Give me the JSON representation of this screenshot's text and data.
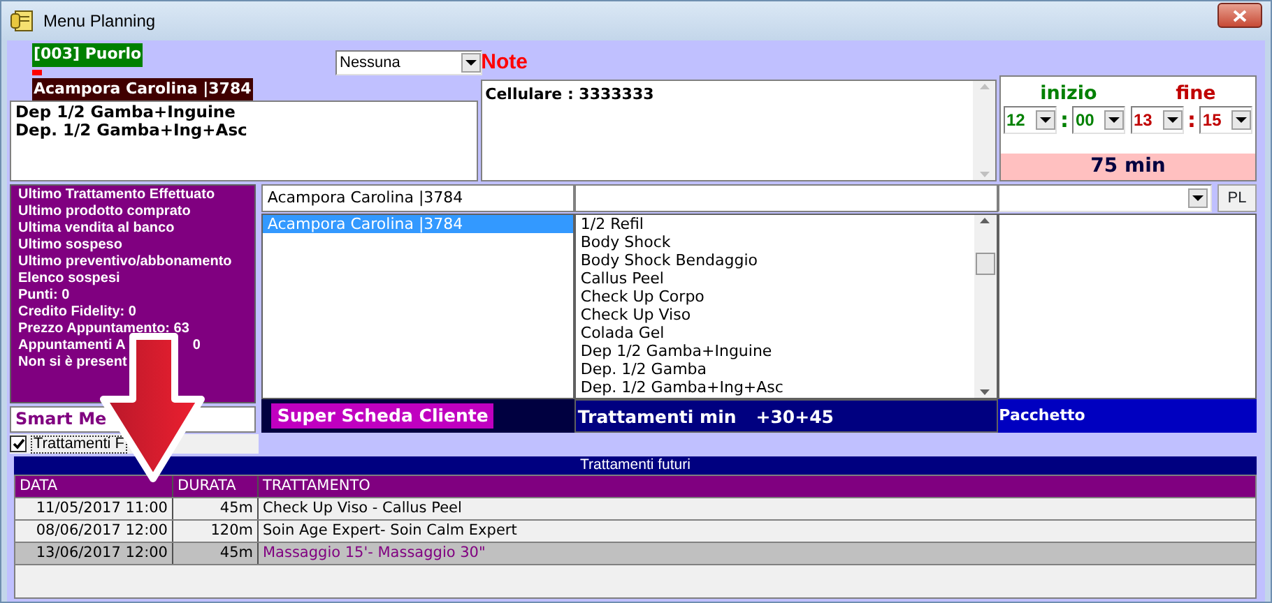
{
  "window": {
    "title": "Menu Planning"
  },
  "client": {
    "code_name": "[003] Puorlo",
    "name": "Acampora Carolina |3784",
    "treatments": [
      "Dep 1/2 Gamba+Inguine",
      "Dep. 1/2 Gamba+Ing+Asc"
    ]
  },
  "note_type": {
    "value": "Nessuna"
  },
  "note": {
    "label": "Note",
    "text": "Cellulare : 3333333"
  },
  "time": {
    "start_label": "inizio",
    "end_label": "fine",
    "start_hour": "12",
    "start_separator": ":",
    "start_minute": "00",
    "end_hour": "13",
    "end_separator": ":",
    "end_minute": "15",
    "duration": "75 min"
  },
  "info_menu": [
    {
      "text": "Ultimo Trattamento Effettuato"
    },
    {
      "text": "Ultimo prodotto comprato"
    },
    {
      "text": "Ultima vendita al banco"
    },
    {
      "text": "Ultimo sospeso"
    },
    {
      "text": "Ultimo preventivo/abbonamento"
    },
    {
      "text": "Elenco sospesi"
    },
    {
      "text": "Punti: 0"
    },
    {
      "text": "Credito Fidelity: 0"
    },
    {
      "text": "Prezzo Appuntamento: 63"
    },
    {
      "text": "Appuntamenti A",
      "tail": "0"
    },
    {
      "text": "Non si è present"
    }
  ],
  "smart_menu": {
    "value": "Smart Me"
  },
  "future_checkbox": {
    "label": "Trattamenti F",
    "checked": true
  },
  "customer_search": {
    "value": "Acampora Carolina |3784"
  },
  "customers": [
    {
      "name": "Acampora Carolina |3784",
      "selected": true
    }
  ],
  "customer_footer": "Super Scheda Cliente",
  "treatments": [
    "1/2 Refil",
    "Body Shock",
    "Body Shock Bendaggio",
    "Callus Peel",
    "Check Up Corpo",
    "Check Up Viso",
    "Colada Gel",
    "Dep 1/2 Gamba+Inguine",
    "Dep. 1/2 Gamba",
    "Dep. 1/2 Gamba+Ing+Asc"
  ],
  "treatment_footer": {
    "label": "Trattamenti min",
    "extra": "+30+45"
  },
  "package": {
    "button": "PL",
    "footer": "Pacchetto"
  },
  "future": {
    "title": "Trattamenti futuri",
    "columns": [
      "DATA",
      "DURATA",
      "TRATTAMENTO"
    ],
    "rows": [
      {
        "cells": [
          "11/05/2017 11:00",
          "45m",
          "Check Up Viso - Callus Peel"
        ],
        "selected": false
      },
      {
        "cells": [
          "08/06/2017 12:00",
          "120m",
          "Soin Age  Expert- Soin Calm Expert"
        ],
        "selected": false
      },
      {
        "cells": [
          "13/06/2017 12:00",
          "45m",
          "Massaggio 15'- Massaggio 30\""
        ],
        "selected": true
      }
    ]
  }
}
